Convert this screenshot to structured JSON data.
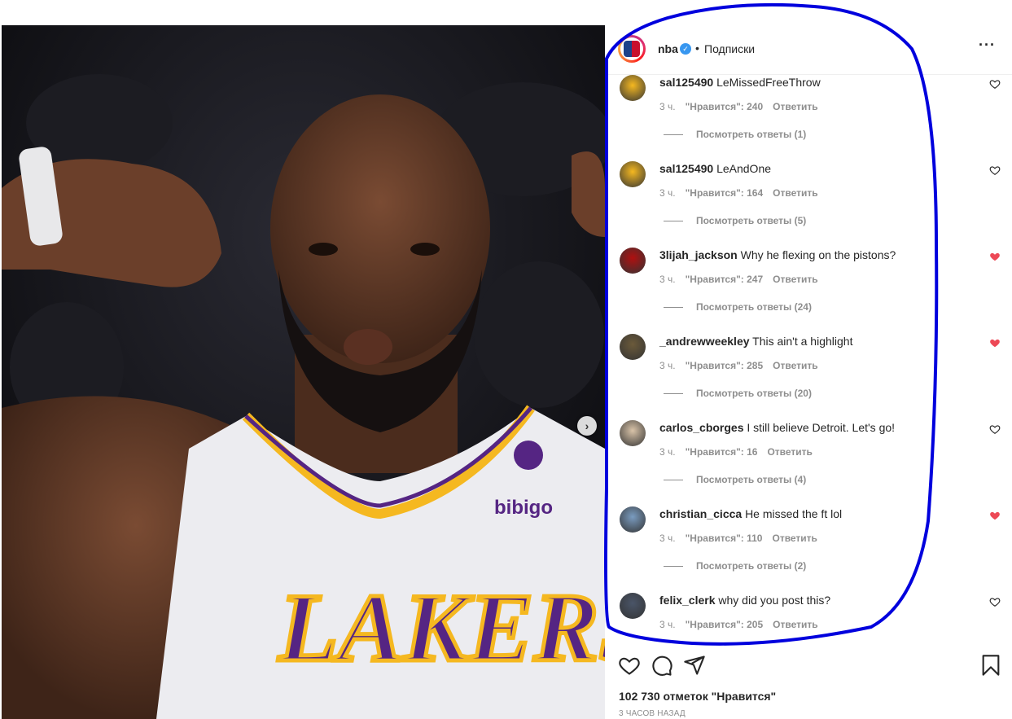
{
  "post": {
    "account": "nba",
    "follow_status": "Подписки",
    "more_icon": "more-icon",
    "likes_text": "102 730 отметок \"Нравится\"",
    "time_text": "3 часов назад",
    "photo_text": "LAKERS",
    "jersey_sponsor": "bibigo"
  },
  "comments": [
    {
      "user": "sal125490",
      "text": "LeMissedFreeThrow",
      "time": "3 ч.",
      "likes": "\"Нравится\": 240",
      "reply": "Ответить",
      "replies": "Посмотреть ответы (1)",
      "liked": false
    },
    {
      "user": "sal125490",
      "text": "LeAndOne",
      "time": "3 ч.",
      "likes": "\"Нравится\": 164",
      "reply": "Ответить",
      "replies": "Посмотреть ответы (5)",
      "liked": false
    },
    {
      "user": "3lijah_jackson",
      "text": "Why he flexing on the pistons?",
      "time": "3 ч.",
      "likes": "\"Нравится\": 247",
      "reply": "Ответить",
      "replies": "Посмотреть ответы (24)",
      "liked": true
    },
    {
      "user": "_andrewweekley",
      "text": "This ain't a highlight",
      "time": "3 ч.",
      "likes": "\"Нравится\": 285",
      "reply": "Ответить",
      "replies": "Посмотреть ответы (20)",
      "liked": true
    },
    {
      "user": "carlos_cborges",
      "text": "I still believe Detroit. Let's go!",
      "time": "3 ч.",
      "likes": "\"Нравится\": 16",
      "reply": "Ответить",
      "replies": "Посмотреть ответы (4)",
      "liked": false
    },
    {
      "user": "christian_cicca",
      "text": "He missed the ft lol",
      "time": "3 ч.",
      "likes": "\"Нравится\": 110",
      "reply": "Ответить",
      "replies": "Посмотреть ответы (2)",
      "liked": true
    },
    {
      "user": "felix_clerk",
      "text": "why did you post this?",
      "time": "3 ч.",
      "likes": "\"Нравится\": 205",
      "reply": "Ответить",
      "replies": "",
      "liked": false
    }
  ],
  "icons": {
    "like": "heart-icon",
    "comment": "comment-icon",
    "share": "share-icon",
    "save": "bookmark-icon",
    "next": "chevron-right-icon"
  },
  "colors": {
    "liked_heart": "#ed4956",
    "annotation": "#0000dd",
    "verified": "#3897f0"
  }
}
